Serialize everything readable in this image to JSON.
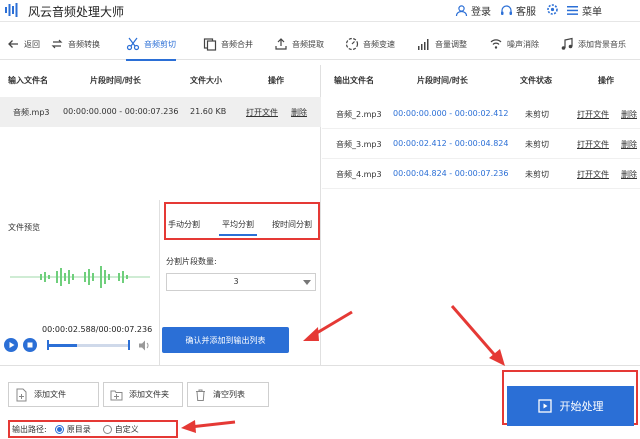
{
  "app": {
    "title": "风云音频处理大师",
    "login": "登录",
    "service": "客服",
    "menu": "菜单"
  },
  "toolbar": {
    "back": "返回",
    "tools": [
      {
        "label": "音频转换",
        "icon": "convert-icon"
      },
      {
        "label": "音频剪切",
        "icon": "scissors-icon",
        "active": true
      },
      {
        "label": "音频合并",
        "icon": "merge-icon"
      },
      {
        "label": "音频提取",
        "icon": "extract-icon"
      },
      {
        "label": "音频变速",
        "icon": "speed-icon"
      },
      {
        "label": "音量调整",
        "icon": "volume-bars-icon"
      },
      {
        "label": "噪声消除",
        "icon": "noise-icon"
      },
      {
        "label": "添加背景音乐",
        "icon": "music-note-icon"
      }
    ]
  },
  "input_table": {
    "headers": [
      "输入文件名",
      "片段时间/时长",
      "文件大小",
      "操作"
    ],
    "rows": [
      {
        "name": "音频.mp3",
        "time": "00:00:00.000 - 00:00:07.236",
        "size": "21.60 KB",
        "open": "打开文件",
        "delete": "删除"
      }
    ]
  },
  "output_table": {
    "headers": [
      "输出文件名",
      "片段时间/时长",
      "文件状态",
      "操作"
    ],
    "rows": [
      {
        "name": "音频_2.mp3",
        "time": "00:00:00.000 - 00:00:02.412",
        "status": "未剪切",
        "open": "打开文件",
        "delete": "删除"
      },
      {
        "name": "音频_3.mp3",
        "time": "00:00:02.412 - 00:00:04.824",
        "status": "未剪切",
        "open": "打开文件",
        "delete": "删除"
      },
      {
        "name": "音频_4.mp3",
        "time": "00:00:04.824 - 00:00:07.236",
        "status": "未剪切",
        "open": "打开文件",
        "delete": "删除"
      }
    ]
  },
  "preview": {
    "label": "文件预览",
    "time": "00:00:02.588/00:00:07.236",
    "progress_fraction": 0.36
  },
  "split": {
    "tabs": [
      "手动分割",
      "平均分割",
      "按时间分割"
    ],
    "active_tab": 1,
    "count_label": "分割片段数量:",
    "count_value": "3",
    "confirm": "确认并添加到输出列表"
  },
  "bottom": {
    "add_file": "添加文件",
    "add_folder": "添加文件夹",
    "clear_list": "清空列表",
    "output_path_label": "输出路径:",
    "option_original": "原目录",
    "option_custom": "自定义",
    "selected": "原目录",
    "start": "开始处理"
  },
  "colors": {
    "accent": "#2b6fd6",
    "annotation": "#e53935",
    "wave": "#6fcf7c"
  }
}
